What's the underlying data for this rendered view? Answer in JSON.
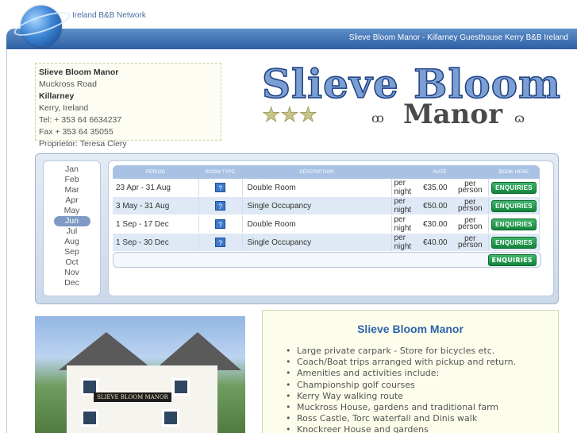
{
  "header": {
    "network_title": "Ireland B&B Network",
    "band_text": "Slieve Bloom Manor - Killarney Guesthouse Kerry B&B Ireland"
  },
  "address": {
    "name": "Slieve Bloom Manor",
    "street": "Muckross Road",
    "town": "Killarney",
    "county": "Kerry, Ireland",
    "tel": "Tel: + 353 64 6634237",
    "fax": "Fax + 353 64 35055",
    "proprietor": "Proprietor: Teresa Clery"
  },
  "logo": {
    "line1": "Slieve Bloom",
    "line2": "Manor",
    "ornament_left": "ꝏ",
    "ornament_right": "ɷ",
    "stars": "★★★"
  },
  "months": {
    "items": [
      "Jan",
      "Feb",
      "Mar",
      "Apr",
      "May",
      "Jun",
      "Jul",
      "Aug",
      "Sep",
      "Oct",
      "Nov",
      "Dec"
    ],
    "selected": "Jun"
  },
  "rates": {
    "headers": {
      "period": "PERIOD",
      "room_type": "ROOM TYPE",
      "description": "DESCRIPTION",
      "rate": "RATE",
      "book": "BOOK HERE"
    },
    "icon": "?",
    "rows": [
      {
        "period": "23 Apr - 31 Aug",
        "description": "Double Room",
        "per_night": "per night",
        "price": "€35.00",
        "per_person": "per person",
        "button": "ENQUIRIES"
      },
      {
        "period": "3 May - 31 Aug",
        "description": "Single Occupancy",
        "per_night": "per night",
        "price": "€50.00",
        "per_person": "per person",
        "button": "ENQUIRIES"
      },
      {
        "period": "1 Sep - 17 Dec",
        "description": "Double Room",
        "per_night": "per night",
        "price": "€30.00",
        "per_person": "per person",
        "button": "ENQUIRIES"
      },
      {
        "period": "1 Sep - 30 Dec",
        "description": "Single Occupancy",
        "per_night": "per night",
        "price": "€40.00",
        "per_person": "per person",
        "button": "ENQUIRIES"
      }
    ],
    "footer_button": "ENQUIRIES"
  },
  "photo": {
    "sign_text": "SLIEVE BLOOM MANOR"
  },
  "info": {
    "title": "Slieve Bloom Manor",
    "items": [
      "Large private carpark - Store for bicycles etc.",
      "Coach/Boat trips arranged with pickup and return.",
      "Amenities and activities include:",
      "Championship golf courses",
      "Kerry Way walking route",
      "Muckross House, gardens and traditional farm",
      "Ross Castle, Torc waterfall and Dinis walk",
      "Knockreer House and gardens"
    ]
  }
}
